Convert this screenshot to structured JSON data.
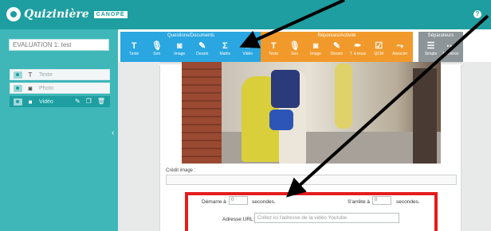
{
  "app": {
    "logo_text": "Quizinière",
    "logo_sub": "CANOPÉ",
    "help_glyph": "?"
  },
  "left_panel": {
    "title_value": "EVALUATION 1: test",
    "items": [
      {
        "icon": "text-icon",
        "glyph": "T",
        "label": "Texte"
      },
      {
        "icon": "camera-icon",
        "glyph": "◙",
        "label": "Photo"
      },
      {
        "icon": "video-icon",
        "glyph": "■",
        "label": "Vidéo"
      }
    ],
    "active_actions": {
      "edit": "✎",
      "copy": "❐",
      "delete": "🗑"
    },
    "collapse_glyph": "‹"
  },
  "toolbar": {
    "questions": {
      "title": "Questions/Documents",
      "tools": [
        {
          "icon": "text-icon",
          "glyph": "T",
          "label": "Texte"
        },
        {
          "icon": "microphone-icon",
          "glyph": "🎙",
          "label": "Son"
        },
        {
          "icon": "camera-icon",
          "glyph": "◙",
          "label": "Image"
        },
        {
          "icon": "pencil-icon",
          "glyph": "✎",
          "label": "Dessin"
        },
        {
          "icon": "sigma-icon",
          "glyph": "Σ",
          "label": "Maths"
        },
        {
          "icon": "video-icon",
          "glyph": "■",
          "label": "Vidéo"
        }
      ]
    },
    "answers": {
      "title": "Réponses/Activité",
      "tools": [
        {
          "icon": "text-icon",
          "glyph": "T",
          "label": "Texte"
        },
        {
          "icon": "microphone-icon",
          "glyph": "🎙",
          "label": "Son"
        },
        {
          "icon": "camera-icon",
          "glyph": "◙",
          "label": "Image"
        },
        {
          "icon": "pencil-icon",
          "glyph": "✎",
          "label": "Dessin"
        },
        {
          "icon": "pen-icon",
          "glyph": "✒",
          "label": "T. à trous"
        },
        {
          "icon": "checkbox-icon",
          "glyph": "☑",
          "label": "QCM"
        },
        {
          "icon": "link-icon",
          "glyph": "⤳",
          "label": "Associer"
        }
      ]
    },
    "separators": {
      "title": "Séparateurs",
      "tools": [
        {
          "icon": "list-icon",
          "glyph": "☰",
          "label": "Simple"
        },
        {
          "icon": "dots-icon",
          "glyph": "⋯",
          "label": "Numéros"
        }
      ]
    }
  },
  "main": {
    "image_credit_label": "Crédit image :",
    "image_credit_value": "",
    "video": {
      "start_label": "Démarre à",
      "start_value": "0",
      "start_unit": "secondes.",
      "stop_label": "S'arrête à",
      "stop_value": "0",
      "stop_unit": "secondes.",
      "url_label": "Adresse URL:",
      "url_placeholder": "Collez ici l'adresse de la vidéo Youtube"
    }
  },
  "colors": {
    "teal": "#1e9ea0",
    "panel_teal": "#3fb7b9",
    "blue_group": "#2aa6e0",
    "orange_group": "#f19a2b",
    "grey_group": "#8d9599",
    "highlight_red": "#e41c1c"
  }
}
